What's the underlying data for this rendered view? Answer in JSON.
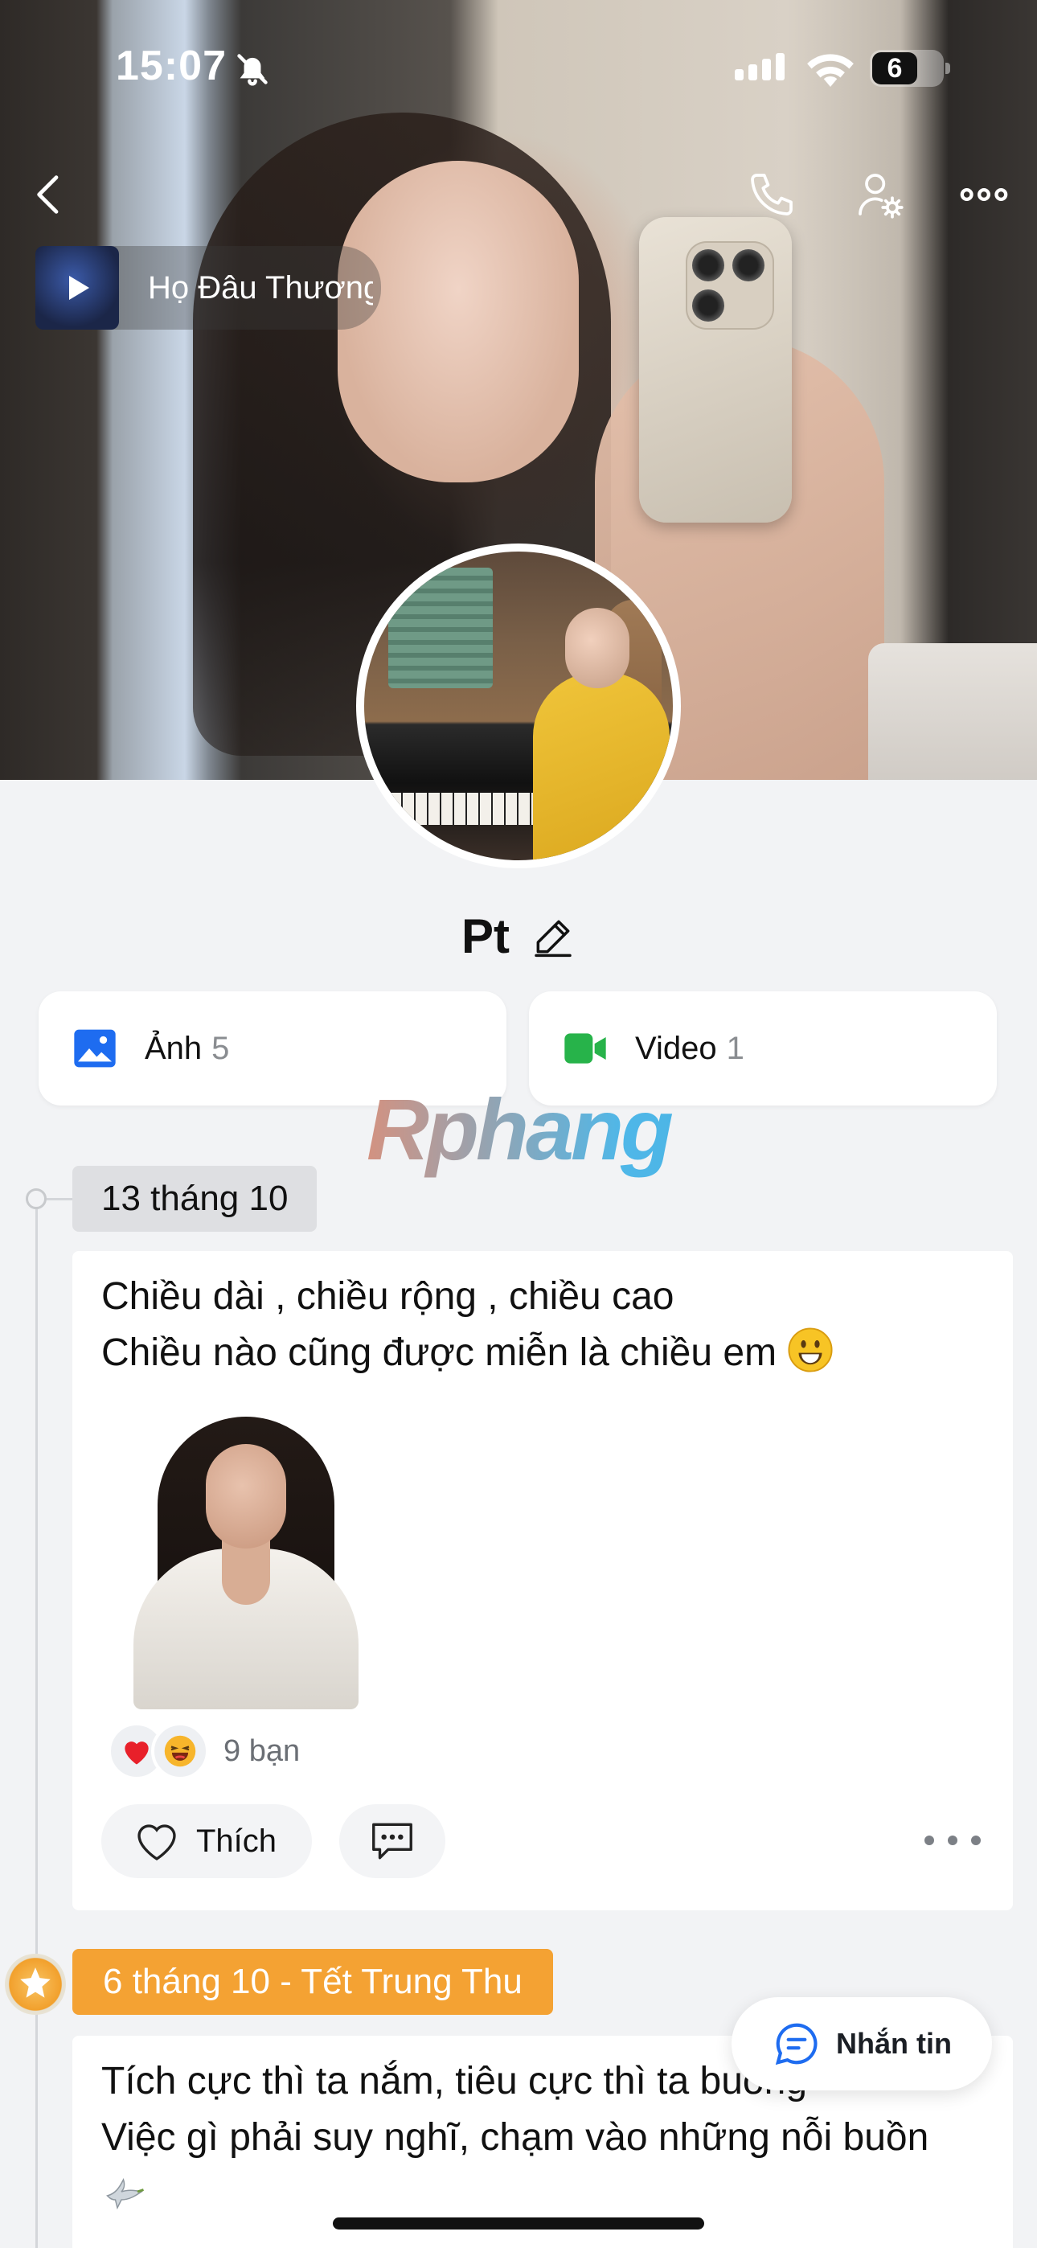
{
  "status_bar": {
    "time": "15:07",
    "battery": "6"
  },
  "music": {
    "title": "Họ Đâu Thương Em"
  },
  "profile": {
    "name": "Pt"
  },
  "media": {
    "photos": {
      "label": "Ảnh",
      "count": "5"
    },
    "videos": {
      "label": "Video",
      "count": "1"
    }
  },
  "watermark": "Rphang",
  "posts": [
    {
      "date": "13 tháng 10",
      "line1": "Chiều dài , chiều rộng , chiều cao",
      "line2": "Chiều nào cũng được miễn là chiều em",
      "reactions_count": "9 bạn",
      "like_label": "Thích"
    },
    {
      "date": "6 tháng 10 - Tết Trung Thu",
      "line1": "Tích cực thì ta nắm, tiêu cực thì ta buông",
      "line2": "Việc gì phải suy nghĩ, chạm vào những nỗi buồn"
    }
  ],
  "message_button": {
    "label": "Nhắn tin"
  },
  "colors": {
    "accent_blue": "#1e6cf0",
    "video_green": "#27b34a",
    "festival_orange": "#f4a233"
  }
}
